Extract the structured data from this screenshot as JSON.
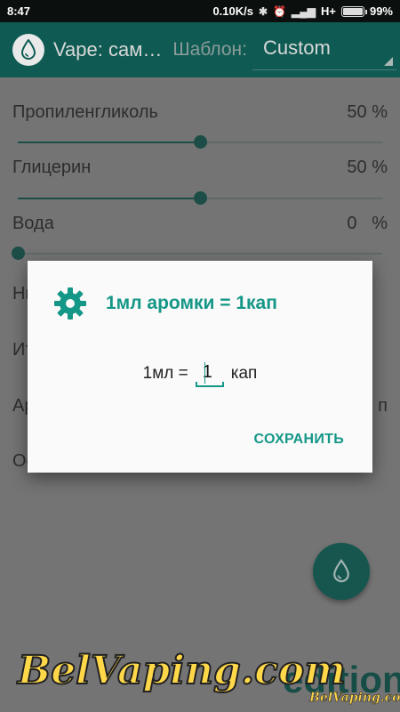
{
  "statusbar": {
    "time": "8:47",
    "network_speed": "0.10K/s",
    "signal_type": "H+",
    "battery": "99%",
    "battery_level": 0.99
  },
  "toolbar": {
    "app_title": "Vape: сам…",
    "template_label": "Шаблон:",
    "template_value": "Custom"
  },
  "ingredients": [
    {
      "label": "Пропиленгликоль",
      "value": "50 %",
      "level": 0.5
    },
    {
      "label": "Глицерин",
      "value": "50 %",
      "level": 0.5
    },
    {
      "label": "Вода",
      "value": "0",
      "unit": "%",
      "level": 0.0
    }
  ],
  "hidden_rows": [
    {
      "label": "Ни"
    },
    {
      "label": "Ит"
    },
    {
      "label": "Ар",
      "right_fragment": "п"
    },
    {
      "label": "Ос"
    }
  ],
  "dialog": {
    "title": "1мл аромки = 1кап",
    "prefix": "1мл =",
    "input_value": "1",
    "suffix": "кап",
    "save_label": "СОХРАНИТЬ"
  },
  "watermark": {
    "brand": "BelVaping.com",
    "edition": "edition",
    "small_brand": "BelVaping.com"
  },
  "colors": {
    "accent": "#149787",
    "toolbar": "#0f5b53"
  }
}
